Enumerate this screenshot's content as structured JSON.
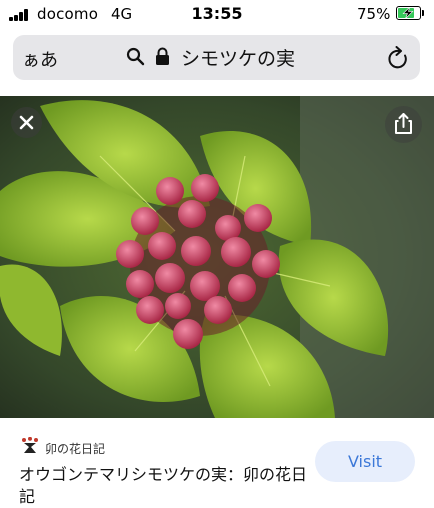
{
  "status_bar": {
    "carrier": "docomo",
    "network": "4G",
    "time": "13:55",
    "battery_percent": "75%",
    "battery_level": 0.75,
    "charging": true,
    "battery_color": "#35c759"
  },
  "address_bar": {
    "text_size_label": "ぁあ",
    "url_text": "シモツケの実",
    "icons": [
      "search-icon",
      "lock-icon",
      "reload-icon"
    ],
    "background": "#e6e6e9"
  },
  "viewer": {
    "icons": [
      "close-icon",
      "share-icon"
    ]
  },
  "result": {
    "source_name": "卯の花日記",
    "title": "オウゴンテマリシモツケの実：卯の花日記",
    "visit_label": "Visit",
    "visit_color": "#3c78d8"
  }
}
